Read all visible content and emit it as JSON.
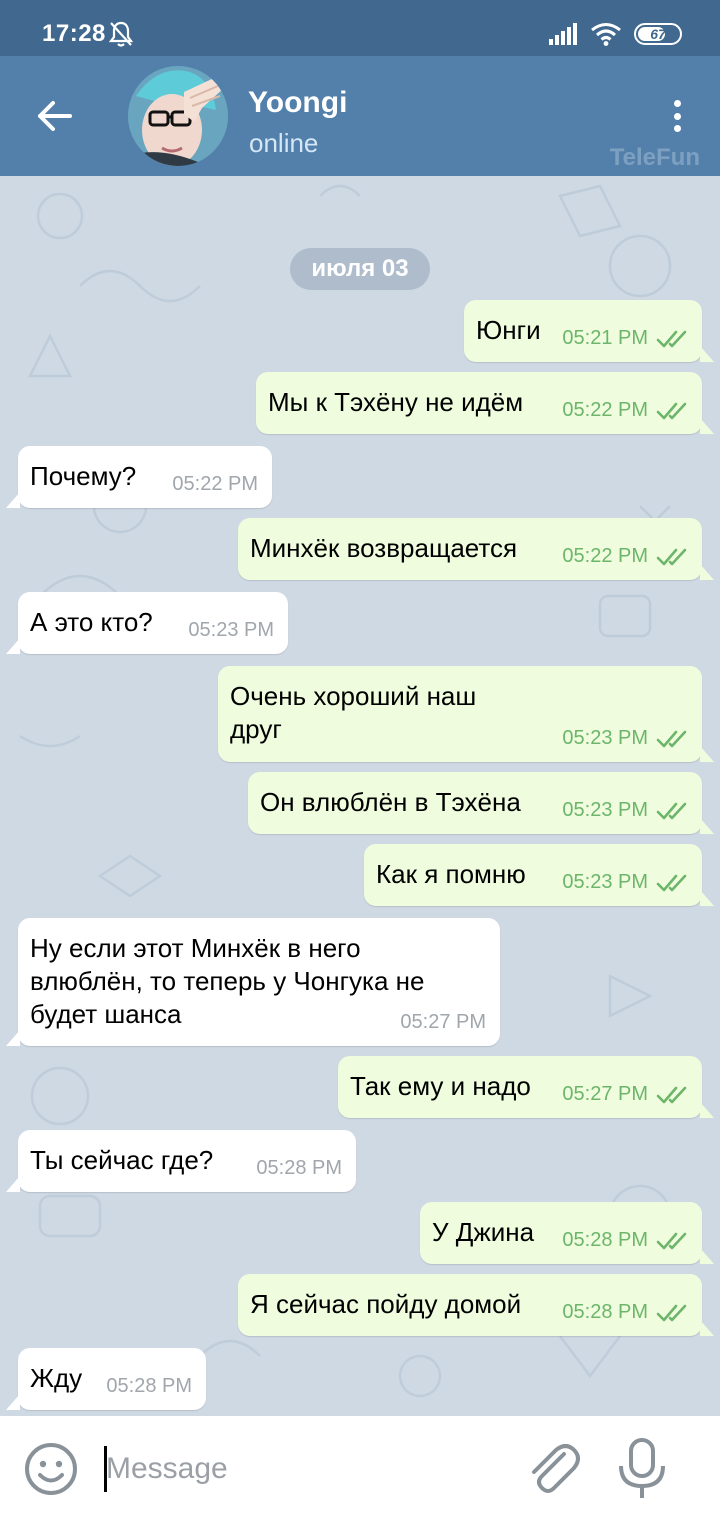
{
  "status_bar": {
    "time": "17:28",
    "battery": "67"
  },
  "header": {
    "name": "Yoongi",
    "status": "online",
    "watermark": "TeleFun"
  },
  "chat": {
    "date": "июля 03",
    "messages": [
      {
        "dir": "out",
        "text": "Юнги",
        "time": "05:21 PM"
      },
      {
        "dir": "out",
        "text": "Мы к Тэхёну не идём",
        "time": "05:22 PM"
      },
      {
        "dir": "in",
        "text": "Почему?",
        "time": "05:22 PM"
      },
      {
        "dir": "out",
        "text": "Минхёк возвращается",
        "time": "05:22 PM"
      },
      {
        "dir": "in",
        "text": "А это кто?",
        "time": "05:23 PM"
      },
      {
        "dir": "out",
        "text": "Очень хороший наш\nдруг",
        "time": "05:23 PM"
      },
      {
        "dir": "out",
        "text": "Он влюблён в Тэхёна",
        "time": "05:23 PM"
      },
      {
        "dir": "out",
        "text": "Как я помню",
        "time": "05:23 PM"
      },
      {
        "dir": "in",
        "text": "Ну если этот Минхёк в него\nвлюблён, то теперь у Чонгука не\nбудет шанса",
        "time": "05:27 PM"
      },
      {
        "dir": "out",
        "text": "Так ему и надо",
        "time": "05:27 PM"
      },
      {
        "dir": "in",
        "text": "Ты сейчас где?",
        "time": "05:28 PM"
      },
      {
        "dir": "out",
        "text": "У Джина",
        "time": "05:28 PM"
      },
      {
        "dir": "out",
        "text": "Я сейчас пойду домой",
        "time": "05:28 PM"
      },
      {
        "dir": "in",
        "text": "Жду",
        "time": "05:28 PM"
      }
    ]
  },
  "input": {
    "placeholder": "Message"
  },
  "colors": {
    "header": "#5280ab",
    "status_bar": "#41698f",
    "outgoing": "#effdde",
    "incoming": "#ffffff",
    "read_check": "#6cb56a"
  }
}
